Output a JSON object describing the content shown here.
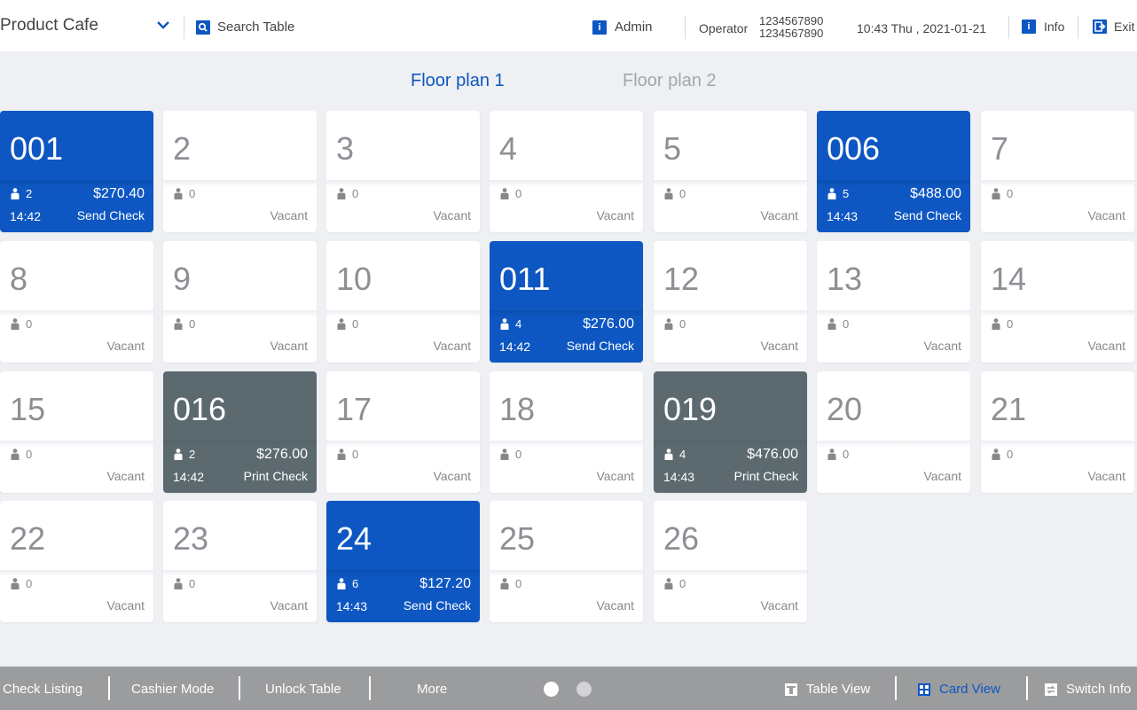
{
  "header": {
    "store_name": "Product Cafe",
    "search_label": "Search Table",
    "user_label": "Admin",
    "operator_label": "Operator",
    "operator_ids": [
      "1234567890",
      "1234567890"
    ],
    "datetime": "10:43 Thu , 2021-01-21",
    "info_label": "Info",
    "exit_label": "Exit"
  },
  "floor_tabs": [
    {
      "label": "Floor plan 1",
      "active": true
    },
    {
      "label": "Floor plan 2",
      "active": false
    }
  ],
  "colors": {
    "accent": "#0e57c2",
    "print_check": "#5c6a70",
    "footer": "#9b9c9e"
  },
  "tables": [
    {
      "number": "001",
      "guests": "2",
      "status": "Send Check",
      "amount": "$270.40",
      "time": "14:42",
      "state": "busy"
    },
    {
      "number": "2",
      "guests": "0",
      "status": "Vacant",
      "state": "vacant"
    },
    {
      "number": "3",
      "guests": "0",
      "status": "Vacant",
      "state": "vacant"
    },
    {
      "number": "4",
      "guests": "0",
      "status": "Vacant",
      "state": "vacant"
    },
    {
      "number": "5",
      "guests": "0",
      "status": "Vacant",
      "state": "vacant"
    },
    {
      "number": "006",
      "guests": "5",
      "status": "Send Check",
      "amount": "$488.00",
      "time": "14:43",
      "state": "busy"
    },
    {
      "number": "7",
      "guests": "0",
      "status": "Vacant",
      "state": "vacant"
    },
    {
      "number": "8",
      "guests": "0",
      "status": "Vacant",
      "state": "vacant"
    },
    {
      "number": "9",
      "guests": "0",
      "status": "Vacant",
      "state": "vacant"
    },
    {
      "number": "10",
      "guests": "0",
      "status": "Vacant",
      "state": "vacant"
    },
    {
      "number": "011",
      "guests": "4",
      "status": "Send Check",
      "amount": "$276.00",
      "time": "14:42",
      "state": "busy"
    },
    {
      "number": "12",
      "guests": "0",
      "status": "Vacant",
      "state": "vacant"
    },
    {
      "number": "13",
      "guests": "0",
      "status": "Vacant",
      "state": "vacant"
    },
    {
      "number": "14",
      "guests": "0",
      "status": "Vacant",
      "state": "vacant"
    },
    {
      "number": "15",
      "guests": "0",
      "status": "Vacant",
      "state": "vacant"
    },
    {
      "number": "016",
      "guests": "2",
      "status": "Print Check",
      "amount": "$276.00",
      "time": "14:42",
      "state": "print"
    },
    {
      "number": "17",
      "guests": "0",
      "status": "Vacant",
      "state": "vacant"
    },
    {
      "number": "18",
      "guests": "0",
      "status": "Vacant",
      "state": "vacant"
    },
    {
      "number": "019",
      "guests": "4",
      "status": "Print Check",
      "amount": "$476.00",
      "time": "14:43",
      "state": "print"
    },
    {
      "number": "20",
      "guests": "0",
      "status": "Vacant",
      "state": "vacant"
    },
    {
      "number": "21",
      "guests": "0",
      "status": "Vacant",
      "state": "vacant"
    },
    {
      "number": "22",
      "guests": "0",
      "status": "Vacant",
      "state": "vacant"
    },
    {
      "number": "23",
      "guests": "0",
      "status": "Vacant",
      "state": "vacant"
    },
    {
      "number": "24",
      "guests": "6",
      "status": "Send Check",
      "amount": "$127.20",
      "time": "14:43",
      "state": "busy"
    },
    {
      "number": "25",
      "guests": "0",
      "status": "Vacant",
      "state": "vacant"
    },
    {
      "number": "26",
      "guests": "0",
      "status": "Vacant",
      "state": "vacant"
    }
  ],
  "footer": {
    "check_listing": "Check Listing",
    "cashier_mode": "Cashier Mode",
    "unlock_table": "Unlock Table",
    "more": "More",
    "table_view": "Table View",
    "card_view": "Card View",
    "switch_info": "Switch Info",
    "pager_pages": 2,
    "pager_current": 1
  }
}
